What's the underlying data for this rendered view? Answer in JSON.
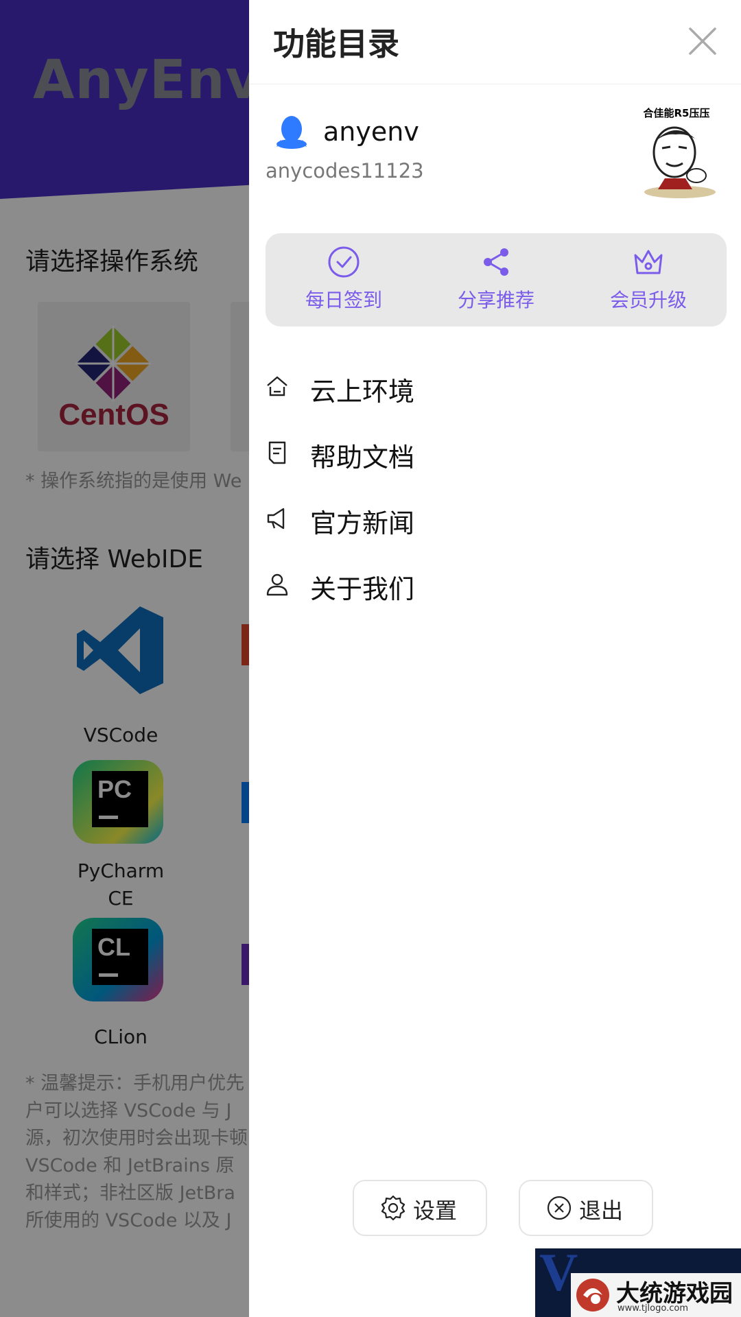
{
  "background": {
    "brand": "AnyEnv",
    "os_section_title": "请选择操作系统",
    "os_card_name": "CentOS",
    "os_note": "* 操作系统指的是使用 We",
    "ide_section_title": "请选择 WebIDE",
    "ides": [
      {
        "label": "VSCode",
        "icon": "vscode-icon"
      },
      {
        "label": "PyCharmCE",
        "icon": "pycharm-icon",
        "abbr": "PC"
      },
      {
        "label": "CLion",
        "icon": "clion-icon",
        "abbr": "CL"
      }
    ],
    "tip_lines": [
      "* 温馨提示：手机用户优先",
      "户可以选择 VSCode 与 J",
      "源，初次使用时会出现卡顿",
      "VSCode 和 JetBrains 原",
      "和样式；非社区版 JetBra",
      "所使用的 VSCode 以及 J"
    ]
  },
  "drawer": {
    "title": "功能目录",
    "close_icon": "close-icon",
    "user": {
      "name": "anyenv",
      "id": "anycodes11123",
      "avatar_caption": "合佳能R5压压",
      "login_icon": "qq-icon"
    },
    "actions": [
      {
        "label": "每日签到",
        "icon": "check-circle-icon"
      },
      {
        "label": "分享推荐",
        "icon": "share-icon"
      },
      {
        "label": "会员升级",
        "icon": "crown-icon"
      }
    ],
    "menu": [
      {
        "label": "云上环境",
        "icon": "home-icon"
      },
      {
        "label": "帮助文档",
        "icon": "document-icon"
      },
      {
        "label": "官方新闻",
        "icon": "megaphone-icon"
      },
      {
        "label": "关于我们",
        "icon": "user-icon"
      }
    ],
    "footer": {
      "settings_label": "设置",
      "logout_label": "退出"
    },
    "accent_color": "#7b5cea"
  },
  "watermark": {
    "text": "大统游戏园",
    "url": "www.tjlogo.com"
  }
}
